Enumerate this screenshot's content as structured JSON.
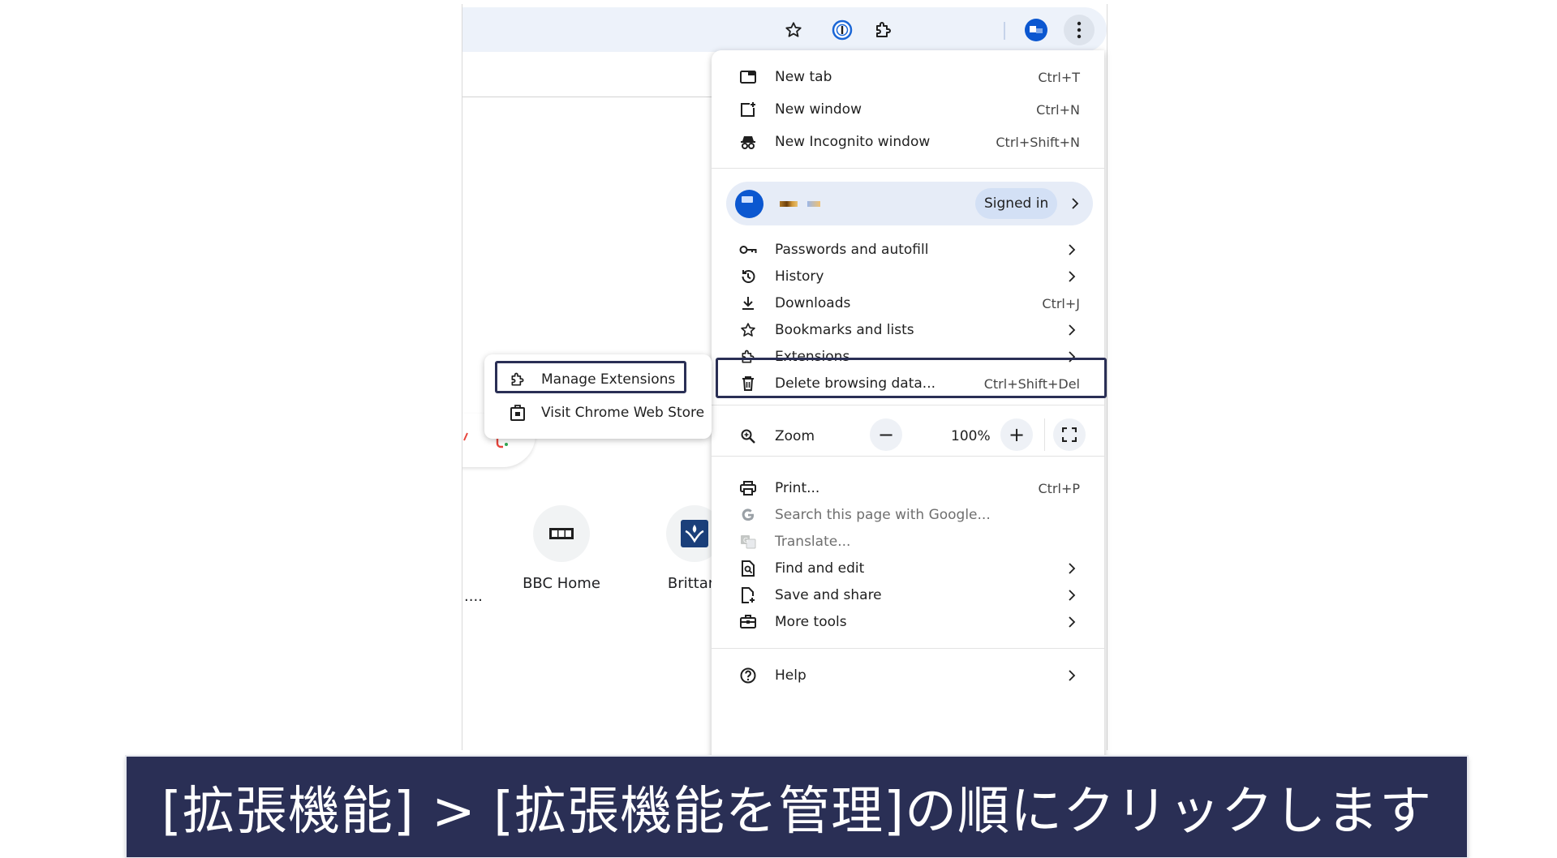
{
  "browser": {
    "toolbar": {
      "bookmark_icon": "star-outline-icon",
      "password_ext_icon": "1password-icon",
      "extensions_icon": "puzzle-icon",
      "profile_icon": "profile-icon",
      "menu_icon": "kebab-menu-icon"
    },
    "shortcuts": [
      {
        "label": "BBC Home"
      },
      {
        "label": "Brittani"
      }
    ],
    "partial_label": "...."
  },
  "menu": {
    "top_items": [
      {
        "label": "New tab",
        "shortcut": "Ctrl+T",
        "icon": "new-tab-icon"
      },
      {
        "label": "New window",
        "shortcut": "Ctrl+N",
        "icon": "new-window-icon"
      },
      {
        "label": "New Incognito window",
        "shortcut": "Ctrl+Shift+N",
        "icon": "incognito-icon"
      }
    ],
    "profile": {
      "status": "Signed in"
    },
    "mid_items": [
      {
        "label": "Passwords and autofill",
        "icon": "key-icon"
      },
      {
        "label": "History",
        "icon": "history-icon"
      },
      {
        "label": "Downloads",
        "shortcut": "Ctrl+J",
        "icon": "download-icon"
      },
      {
        "label": "Bookmarks and lists",
        "icon": "star-icon"
      },
      {
        "label": "Extensions",
        "icon": "puzzle-icon"
      },
      {
        "label": "Delete browsing data...",
        "shortcut": "Ctrl+Shift+Del",
        "icon": "trash-icon"
      }
    ],
    "zoom": {
      "label": "Zoom",
      "value": "100%",
      "minus": "−",
      "plus": "+"
    },
    "bottom_items": [
      {
        "label": "Print...",
        "shortcut": "Ctrl+P",
        "icon": "print-icon"
      },
      {
        "label": "Search this page with Google...",
        "icon": "google-icon"
      },
      {
        "label": "Translate...",
        "icon": "translate-icon"
      },
      {
        "label": "Find and edit",
        "icon": "find-icon"
      },
      {
        "label": "Save and share",
        "icon": "save-share-icon"
      },
      {
        "label": "More tools",
        "icon": "toolbox-icon"
      }
    ],
    "help": {
      "label": "Help",
      "icon": "help-icon"
    }
  },
  "submenu": {
    "items": [
      {
        "label": "Manage Extensions",
        "icon": "puzzle-icon"
      },
      {
        "label": "Visit Chrome Web Store",
        "icon": "web-store-icon"
      }
    ]
  },
  "caption": {
    "text": "[拡張機能] > [拡張機能を管理]の順にクリックします"
  },
  "colors": {
    "highlight": "#2a2f55",
    "caption_bg": "#2a2f55",
    "toolbar_bg": "#edf2fa",
    "accent": "#0b57d0"
  }
}
